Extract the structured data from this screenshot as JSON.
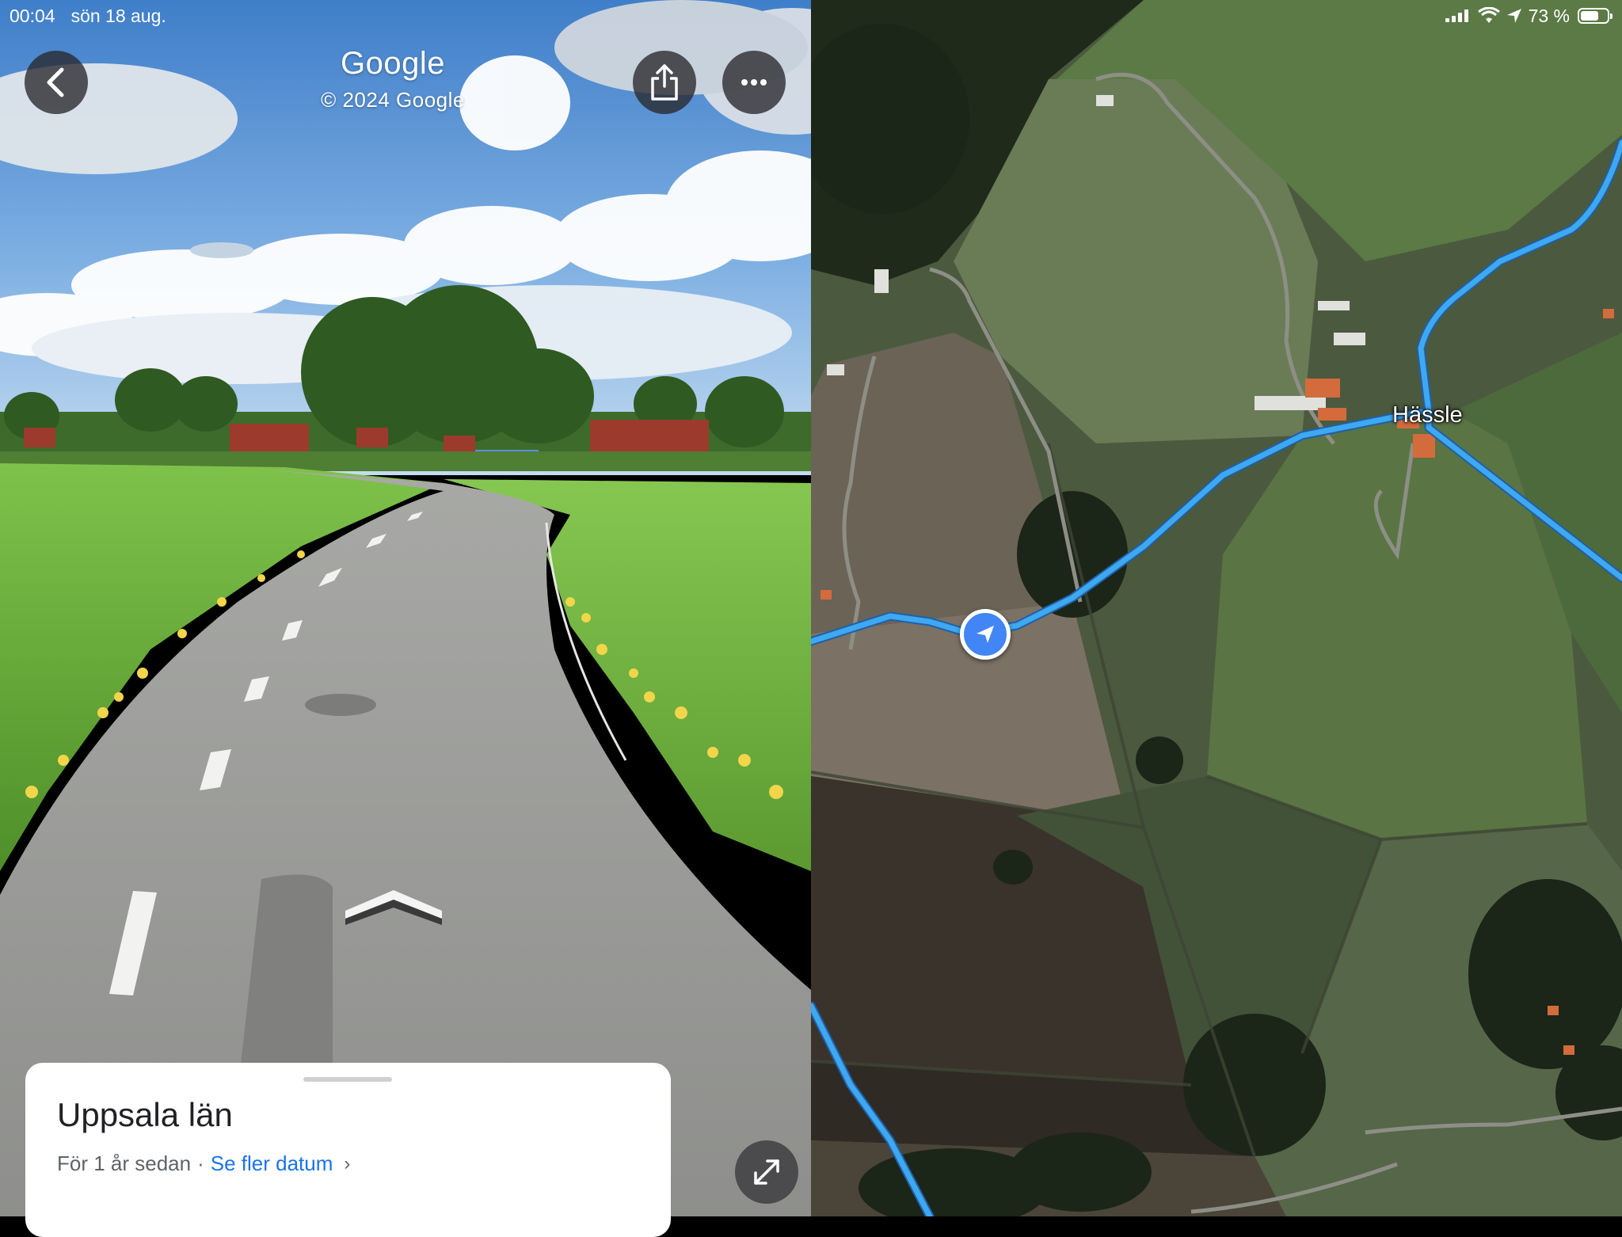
{
  "status_bar": {
    "time": "00:04",
    "date": "sön 18 aug.",
    "battery": "73 %",
    "battery_level": 0.73
  },
  "street_view": {
    "title": "Google",
    "copyright": "© 2024 Google",
    "back_icon": "chevron-left-icon",
    "share_icon": "share-icon",
    "more_icon": "more-horizontal-icon",
    "move_arrow_icon": "navigation-chevron-icon",
    "expand_icon": "expand-diagonal-icon"
  },
  "info_card": {
    "place_name": "Uppsala län",
    "time_ago": "För 1 år sedan",
    "separator": "·",
    "more_dates_link": "Se fler datum",
    "chevron": "›"
  },
  "map": {
    "place_label": "Hässle",
    "location_icon": "navigation-arrow-icon",
    "route_color": "#3ea8f0",
    "puck_color": "#4285f4"
  }
}
